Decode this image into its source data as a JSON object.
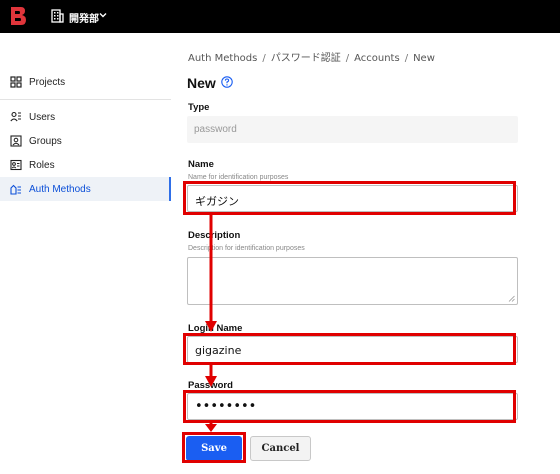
{
  "topbar": {
    "org_name": "開発部"
  },
  "sidebar": {
    "items": [
      {
        "label": "Projects",
        "icon": "projects-icon"
      },
      {
        "label": "Users",
        "icon": "users-icon"
      },
      {
        "label": "Groups",
        "icon": "groups-icon"
      },
      {
        "label": "Roles",
        "icon": "roles-icon"
      },
      {
        "label": "Auth Methods",
        "icon": "auth-methods-icon",
        "active": true
      }
    ]
  },
  "breadcrumb": [
    "Auth Methods",
    "パスワード認証",
    "Accounts",
    "New"
  ],
  "page": {
    "title": "New"
  },
  "form": {
    "type": {
      "label": "Type",
      "value": "password"
    },
    "name": {
      "label": "Name",
      "help": "Name for identification purposes",
      "value": "ギガジン"
    },
    "description": {
      "label": "Description",
      "help": "Description for identification purposes",
      "value": ""
    },
    "login_name": {
      "label": "Login Name",
      "value": "gigazine"
    },
    "password": {
      "label": "Password",
      "value": "••••••••"
    }
  },
  "buttons": {
    "save": "Save",
    "cancel": "Cancel"
  },
  "colors": {
    "highlight": "#e00000",
    "primary": "#1a5ef2",
    "topbar": "#000000",
    "logo": "#e0353b"
  }
}
